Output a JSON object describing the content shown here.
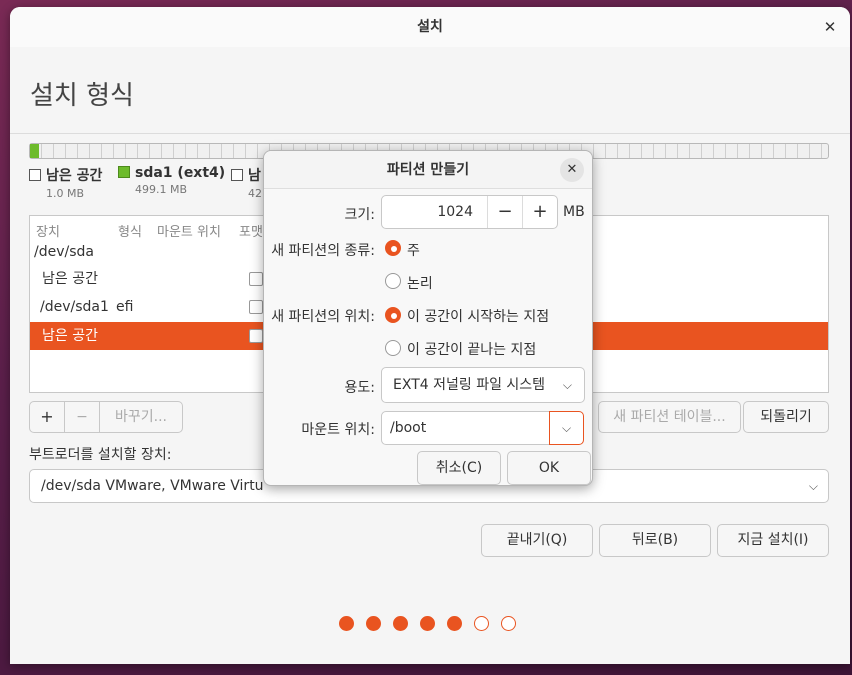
{
  "window": {
    "title": "설치",
    "close_glyph": "✕"
  },
  "page": {
    "title": "설치 형식"
  },
  "legend": [
    {
      "label": "남은 공간",
      "size": "1.0 MB",
      "color": "#ffffff"
    },
    {
      "label": "sda1 (ext4)",
      "size": "499.1 MB",
      "color": "#6dbb2b"
    },
    {
      "label": "남",
      "size": "42",
      "color": "#ffffff"
    }
  ],
  "table": {
    "headers": [
      "장치",
      "형식",
      "마운트 위치",
      "포맷"
    ],
    "rows": [
      {
        "device": "/dev/sda",
        "type": "",
        "mount": "",
        "selected": false,
        "indent": false
      },
      {
        "device": "남은 공간",
        "type": "",
        "mount": "",
        "selected": false,
        "indent": true
      },
      {
        "device": "/dev/sda1",
        "type": "efi",
        "mount": "",
        "selected": false,
        "indent": true
      },
      {
        "device": "남은 공간",
        "type": "",
        "mount": "",
        "selected": true,
        "indent": true
      }
    ]
  },
  "toolbar": {
    "add": "+",
    "remove": "−",
    "change": "바꾸기...",
    "new_table": "새 파티션 테이블...",
    "revert": "되돌리기"
  },
  "bootloader": {
    "label": "부트로더를 설치할 장치:",
    "value": "/dev/sda   VMware, VMware Virtu",
    "chevron": "⌵"
  },
  "nav": {
    "quit": "끝내기(Q)",
    "back": "뒤로(B)",
    "install": "지금 설치(I)"
  },
  "progress": {
    "total_steps": 7,
    "completed_steps": 5,
    "accent": "#e95420"
  },
  "dialog": {
    "title": "파티션 만들기",
    "close_glyph": "✕",
    "size_label": "크기:",
    "size_value": "1024",
    "size_minus": "−",
    "size_plus": "+",
    "size_unit": "MB",
    "type_label": "새 파티션의 종류:",
    "type_primary": "주",
    "type_logical": "논리",
    "type_selected": "primary",
    "location_label": "새 파티션의 위치:",
    "location_start": "이 공간이 시작하는 지점",
    "location_end": "이 공간이 끝나는 지점",
    "location_selected": "start",
    "use_label": "용도:",
    "use_value": "EXT4 저널링 파일 시스템",
    "mount_label": "마운트 위치:",
    "mount_value": "/boot",
    "cancel": "취소(C)",
    "ok": "OK"
  }
}
